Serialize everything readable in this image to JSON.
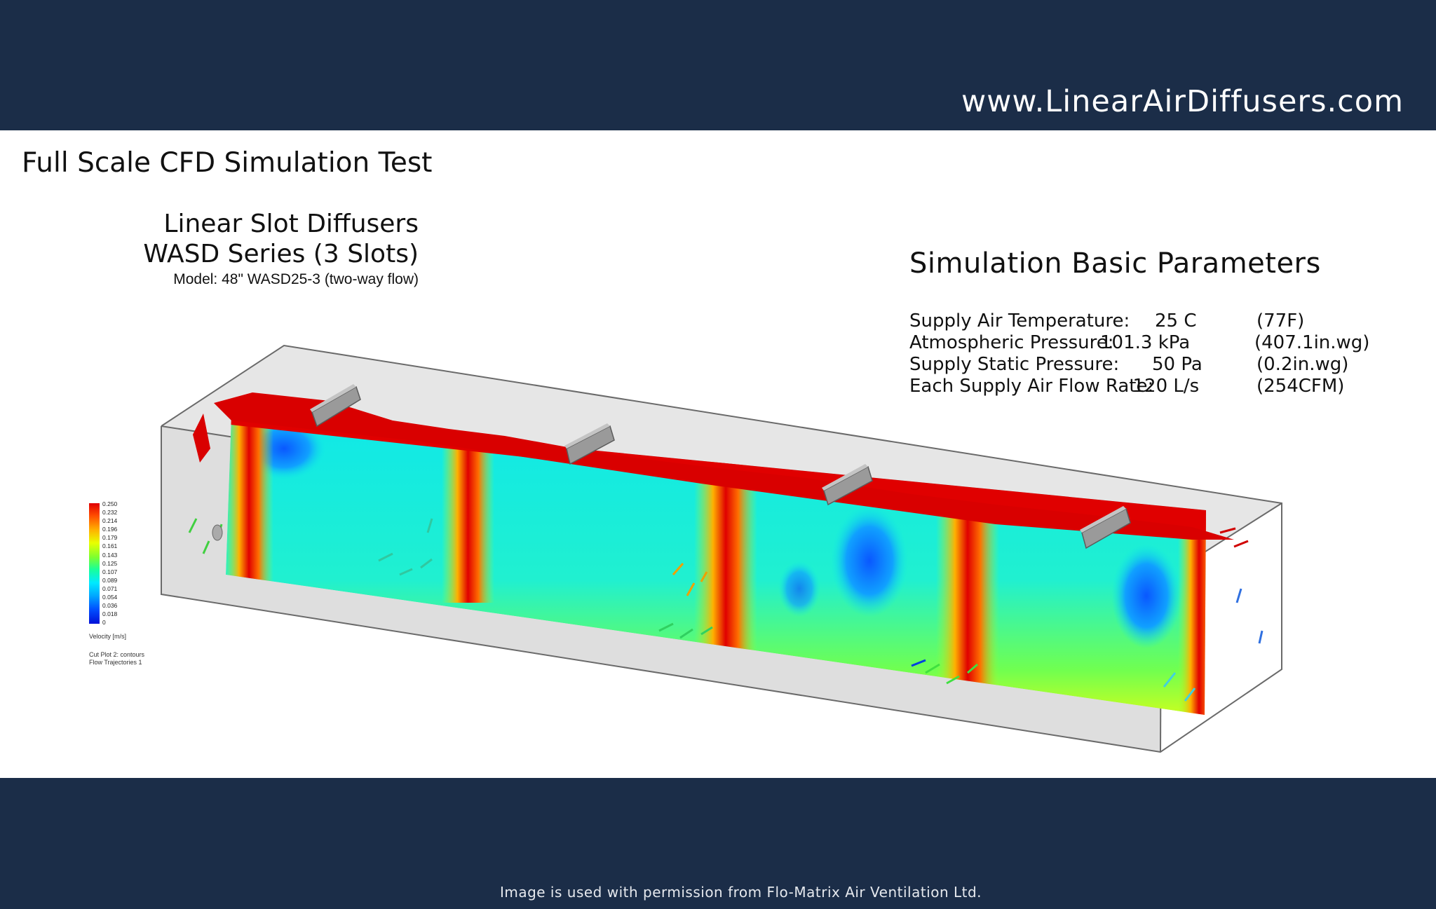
{
  "header": {
    "url": "www.LinearAirDiffusers.com"
  },
  "title": "Full Scale CFD Simulation Test",
  "product": {
    "line1": "Linear Slot Diffusers",
    "line2": "WASD Series (3 Slots)",
    "model": "Model: 48\" WASD25-3 (two-way flow)"
  },
  "parameters": {
    "title": "Simulation Basic Parameters",
    "rows": [
      {
        "label": "Supply Air Temperature:",
        "value": "25 C",
        "imperial": "(77F)"
      },
      {
        "label": "Atmospheric Pressure:",
        "value": "101.3 kPa",
        "imperial": "(407.1in.wg)"
      },
      {
        "label": "Supply Static Pressure:",
        "value": "50 Pa",
        "imperial": "(0.2in.wg)"
      },
      {
        "label": "Each Supply Air Flow Rate:",
        "value": "120 L/s",
        "imperial": "(254CFM)"
      }
    ]
  },
  "legend": {
    "ticks": [
      "0.250",
      "0.232",
      "0.214",
      "0.196",
      "0.179",
      "0.161",
      "0.143",
      "0.125",
      "0.107",
      "0.089",
      "0.071",
      "0.054",
      "0.036",
      "0.018",
      "0"
    ],
    "unit_label": "Velocity [m/s]",
    "note1": "Cut Plot 2: contours",
    "note2": "Flow Trajectories 1"
  },
  "footer": {
    "note": "Image is used with permission from Flo-Matrix Air Ventilation Ltd."
  },
  "colors": {
    "band": "#1b2d48",
    "high_velocity": "#e00000",
    "low_velocity": "#00eaff"
  }
}
